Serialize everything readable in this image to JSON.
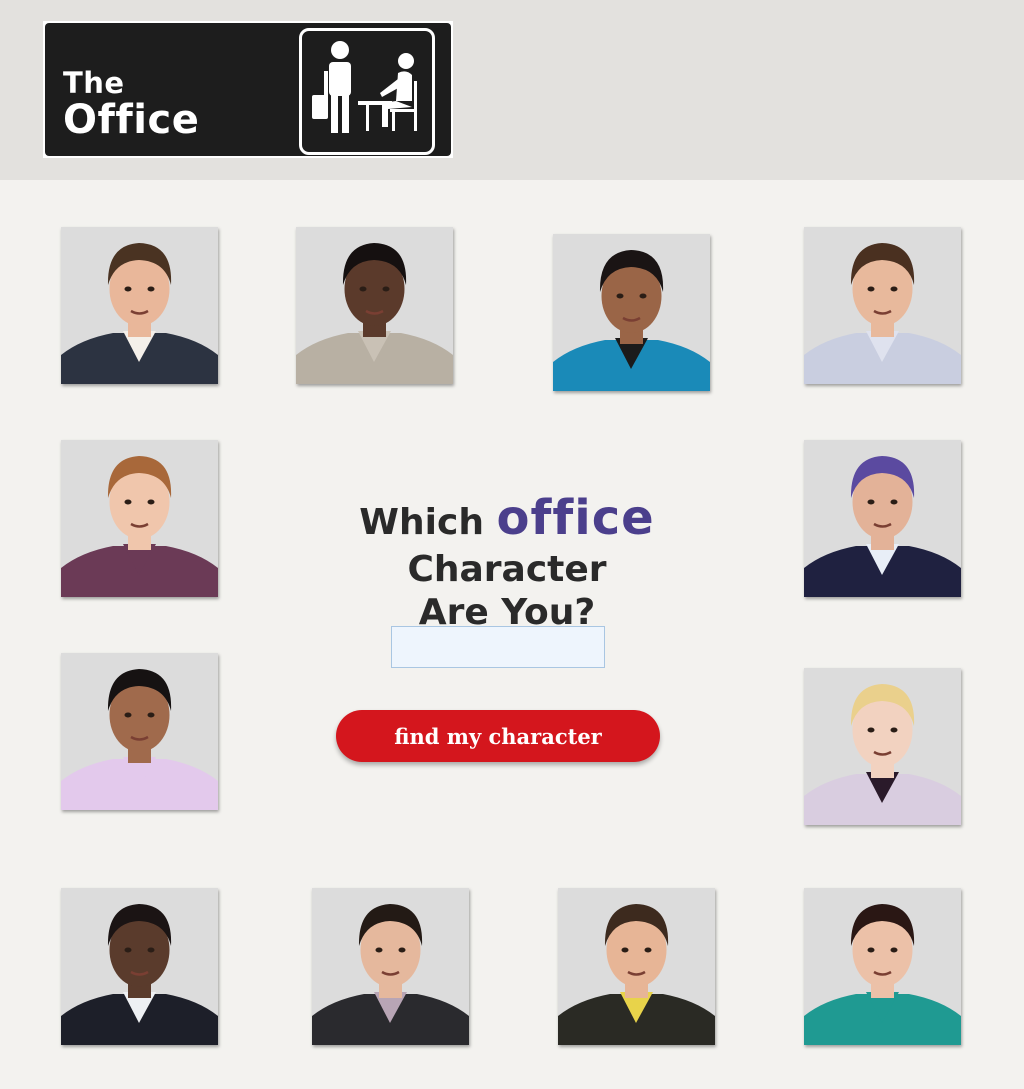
{
  "header": {
    "logo": {
      "line1": "The",
      "line2": "Office",
      "icon": "office-sign-icon"
    },
    "background": "#e3e1de"
  },
  "main": {
    "title": {
      "before": "Which",
      "accent": "office",
      "after": "Character",
      "line2": "Are You?"
    },
    "name_input": {
      "value": "",
      "placeholder": ""
    },
    "find_button_label": "find my character"
  },
  "portraits": [
    {
      "icon": "character-portrait-icon",
      "skin": "#e9b79a",
      "hair": "#4a3322",
      "shirt": "#2c3341",
      "collar": "#f4f0ea"
    },
    {
      "icon": "character-portrait-icon",
      "skin": "#5b3a2b",
      "hair": "#151010",
      "shirt": "#b8b0a3",
      "collar": "#c9c1b5"
    },
    {
      "icon": "character-portrait-icon",
      "skin": "#9a6547",
      "hair": "#1a1414",
      "shirt": "#1a8ab8",
      "collar": "#1b1b1b"
    },
    {
      "icon": "character-portrait-icon",
      "skin": "#e8b99c",
      "hair": "#4a3020",
      "shirt": "#c9cee0",
      "collar": "#dfe2ee"
    },
    {
      "icon": "character-portrait-icon",
      "skin": "#f0c6ac",
      "hair": "#a8683a",
      "shirt": "#6b3a56",
      "collar": "#6b3a56"
    },
    {
      "icon": "character-portrait-icon",
      "skin": "#e3b298",
      "hair": "#5b4aa0",
      "shirt": "#1f2140",
      "collar": "#e8eef7"
    },
    {
      "icon": "character-portrait-icon",
      "skin": "#a06a4c",
      "hair": "#161212",
      "shirt": "#e3c9ec",
      "collar": "#e3c9ec"
    },
    {
      "icon": "character-portrait-icon",
      "skin": "#f2d2c0",
      "hair": "#ead08c",
      "shirt": "#d9cde0",
      "collar": "#2a1a2a"
    },
    {
      "icon": "character-portrait-icon",
      "skin": "#5a3b2c",
      "hair": "#1b1414",
      "shirt": "#1d1f29",
      "collar": "#eef0f3"
    },
    {
      "icon": "character-portrait-icon",
      "skin": "#e5b89d",
      "hair": "#231a15",
      "shirt": "#2a2a2e",
      "collar": "#b8a5b5"
    },
    {
      "icon": "character-portrait-icon",
      "skin": "#e7b596",
      "hair": "#3d2a1e",
      "shirt": "#2a2a24",
      "collar": "#e8d34a"
    },
    {
      "icon": "character-portrait-icon",
      "skin": "#ecc1a8",
      "hair": "#2a1714",
      "shirt": "#1f9a92",
      "collar": "#1f9a92"
    }
  ]
}
